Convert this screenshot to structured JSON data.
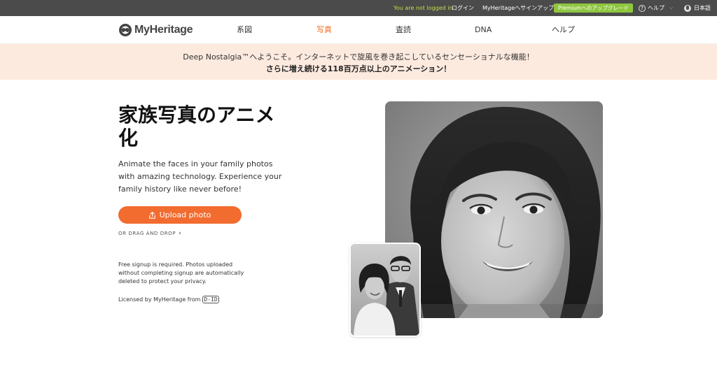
{
  "topbar": {
    "status": "You are not logged in",
    "login": "ログイン",
    "signup": "MyHeritageへサインアップ",
    "premium": "Premiumへのアップグレード",
    "help": "ヘルプ",
    "help_icon": "question-circle-icon",
    "language": "日本語",
    "language_icon": "globe-icon",
    "status_color": "#c9d94a",
    "premium_color": "#8ec63f"
  },
  "nav": {
    "logo_text": "MyHeritage",
    "items": [
      {
        "label": "系図"
      },
      {
        "label": "写真"
      },
      {
        "label": "査読"
      },
      {
        "label": "DNA"
      },
      {
        "label": "ヘルプ"
      }
    ],
    "active_index": 1,
    "accent_color": "#f26b21"
  },
  "banner": {
    "line1": "Deep Nostalgia™へようこそ。インターネットで旋風を巻き起こしているセンセーショナルな機能！",
    "line2": "さらに増え続ける118百万点以上のアニメーション！"
  },
  "hero": {
    "title": "家族写真のアニメ化",
    "description": "Animate the faces in your family photos with amazing technology. Experience your family history like never before!",
    "upload_label": "Upload photo",
    "upload_icon": "upload-icon",
    "drag_drop": "OR DRAG AND DROP",
    "signup_note": "Free signup is required. Photos uploaded without completing signup are automatically deleted to protect your privacy.",
    "licensed": "Licensed by MyHeritage from",
    "licensor_logo_text": "D-ID"
  }
}
